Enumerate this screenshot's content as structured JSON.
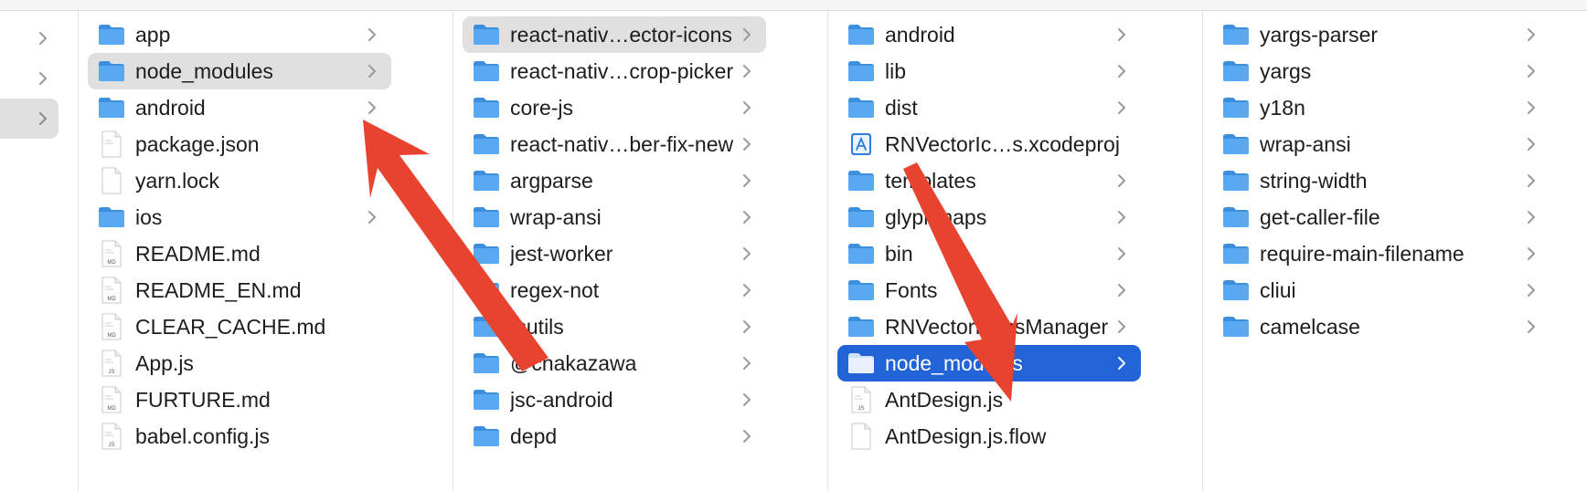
{
  "colors": {
    "folder": "#5aa9f0",
    "folder_dark": "#3c8fdc",
    "selection_gray": "#e0e0e0",
    "selection_blue": "#2363d8",
    "arrow": "#e8432e"
  },
  "columns": [
    {
      "items": [
        {
          "label": "app",
          "icon": "folder-icon",
          "chevron": true
        },
        {
          "label": "node_modules",
          "icon": "folder-icon",
          "chevron": true,
          "selected": "gray"
        },
        {
          "label": "android",
          "icon": "folder-icon",
          "chevron": true
        },
        {
          "label": "package.json",
          "icon": "document-icon",
          "chevron": false
        },
        {
          "label": "yarn.lock",
          "icon": "blank-document-icon",
          "chevron": false
        },
        {
          "label": "ios",
          "icon": "folder-icon",
          "chevron": true
        },
        {
          "label": "README.md",
          "icon": "md-document-icon",
          "badge": "MD",
          "chevron": false
        },
        {
          "label": "README_EN.md",
          "icon": "md-document-icon",
          "badge": "MD",
          "chevron": false
        },
        {
          "label": "CLEAR_CACHE.md",
          "icon": "md-document-icon",
          "badge": "MD",
          "chevron": false
        },
        {
          "label": "App.js",
          "icon": "js-document-icon",
          "badge": "JS",
          "chevron": false
        },
        {
          "label": "FURTURE.md",
          "icon": "md-document-icon",
          "badge": "MD",
          "chevron": false
        },
        {
          "label": "babel.config.js",
          "icon": "js-document-icon",
          "badge": "JS",
          "chevron": false
        }
      ]
    },
    {
      "items": [
        {
          "label": "react-nativ…ector-icons",
          "icon": "folder-icon",
          "chevron": true,
          "selected": "gray"
        },
        {
          "label": "react-nativ…crop-picker",
          "icon": "folder-icon",
          "chevron": true
        },
        {
          "label": "core-js",
          "icon": "folder-icon",
          "chevron": true
        },
        {
          "label": "react-nativ…ber-fix-new",
          "icon": "folder-icon",
          "chevron": true
        },
        {
          "label": "argparse",
          "icon": "folder-icon",
          "chevron": true
        },
        {
          "label": "wrap-ansi",
          "icon": "folder-icon",
          "chevron": true
        },
        {
          "label": "jest-worker",
          "icon": "folder-icon",
          "chevron": true
        },
        {
          "label": "regex-not",
          "icon": "folder-icon",
          "chevron": true
        },
        {
          "label": "tsutils",
          "icon": "folder-icon",
          "chevron": true
        },
        {
          "label": "@cnakazawa",
          "icon": "folder-icon",
          "chevron": true
        },
        {
          "label": "jsc-android",
          "icon": "folder-icon",
          "chevron": true
        },
        {
          "label": "depd",
          "icon": "folder-icon",
          "chevron": true
        }
      ]
    },
    {
      "items": [
        {
          "label": "android",
          "icon": "folder-icon",
          "chevron": true
        },
        {
          "label": "lib",
          "icon": "folder-icon",
          "chevron": true
        },
        {
          "label": "dist",
          "icon": "folder-icon",
          "chevron": true
        },
        {
          "label": "RNVectorIc…s.xcodeproj",
          "icon": "xcodeproj-icon",
          "chevron": false
        },
        {
          "label": "templates",
          "icon": "folder-icon",
          "chevron": true
        },
        {
          "label": "glyphmaps",
          "icon": "folder-icon",
          "chevron": true
        },
        {
          "label": "bin",
          "icon": "folder-icon",
          "chevron": true
        },
        {
          "label": "Fonts",
          "icon": "folder-icon",
          "chevron": true
        },
        {
          "label": "RNVectorIconsManager",
          "icon": "folder-icon",
          "chevron": true
        },
        {
          "label": "node_modules",
          "icon": "folder-icon",
          "chevron": true,
          "selected": "blue"
        },
        {
          "label": "AntDesign.js",
          "icon": "js-document-icon",
          "badge": "JS",
          "chevron": false
        },
        {
          "label": "AntDesign.js.flow",
          "icon": "blank-document-icon",
          "chevron": false
        }
      ]
    },
    {
      "items": [
        {
          "label": "yargs-parser",
          "icon": "folder-icon",
          "chevron": true
        },
        {
          "label": "yargs",
          "icon": "folder-icon",
          "chevron": true
        },
        {
          "label": "y18n",
          "icon": "folder-icon",
          "chevron": true
        },
        {
          "label": "wrap-ansi",
          "icon": "folder-icon",
          "chevron": true
        },
        {
          "label": "string-width",
          "icon": "folder-icon",
          "chevron": true
        },
        {
          "label": "get-caller-file",
          "icon": "folder-icon",
          "chevron": true
        },
        {
          "label": "require-main-filename",
          "icon": "folder-icon",
          "chevron": true
        },
        {
          "label": "cliui",
          "icon": "folder-icon",
          "chevron": true
        },
        {
          "label": "camelcase",
          "icon": "folder-icon",
          "chevron": true
        }
      ]
    }
  ]
}
